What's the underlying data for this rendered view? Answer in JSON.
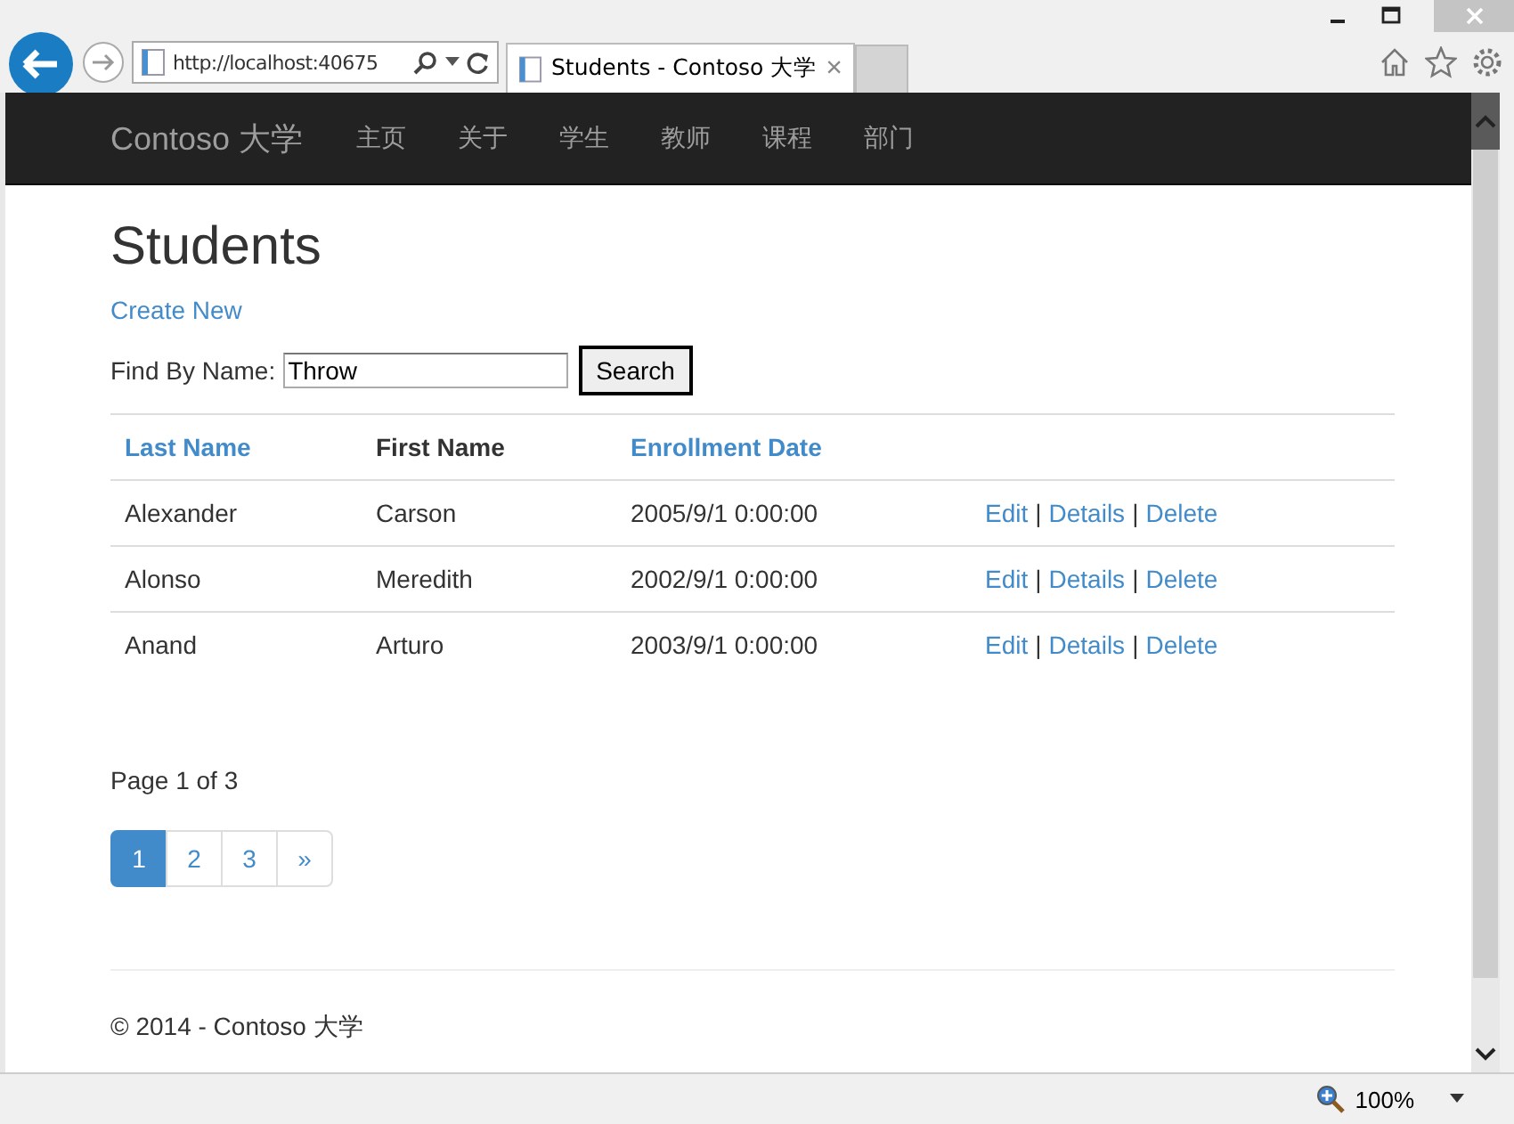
{
  "browser": {
    "address": "http://localhost:40675",
    "tab_title": "Students - Contoso 大学",
    "tab_close": "×",
    "zoom": "100%"
  },
  "navbar": {
    "brand": "Contoso 大学",
    "items": [
      "主页",
      "关于",
      "学生",
      "教师",
      "课程",
      "部门"
    ]
  },
  "page": {
    "title": "Students",
    "create_link": "Create New",
    "search_label": "Find By Name:",
    "search_value": "Throw",
    "search_button": "Search"
  },
  "table": {
    "columns": [
      {
        "label": "Last Name",
        "kind": "link"
      },
      {
        "label": "First Name",
        "kind": "text"
      },
      {
        "label": "Enrollment Date",
        "kind": "link"
      }
    ],
    "rows": [
      {
        "cells": [
          "Alexander",
          "Carson",
          "2005/9/1 0:00:00"
        ],
        "actions": [
          {
            "label": "Edit",
            "kind": "link"
          },
          {
            "label": "|",
            "kind": "separator"
          },
          {
            "label": "Details",
            "kind": "link"
          },
          {
            "label": "|",
            "kind": "separator"
          },
          {
            "label": "Delete",
            "kind": "link"
          }
        ]
      },
      {
        "cells": [
          "Alonso",
          "Meredith",
          "2002/9/1 0:00:00"
        ],
        "actions": [
          {
            "label": "Edit",
            "kind": "link"
          },
          {
            "label": "|",
            "kind": "separator"
          },
          {
            "label": "Details",
            "kind": "link"
          },
          {
            "label": "|",
            "kind": "separator"
          },
          {
            "label": "Delete",
            "kind": "link"
          }
        ]
      },
      {
        "cells": [
          "Anand",
          "Arturo",
          "2003/9/1 0:00:00"
        ],
        "actions": [
          {
            "label": "Edit",
            "kind": "link"
          },
          {
            "label": "|",
            "kind": "separator"
          },
          {
            "label": "Details",
            "kind": "link"
          },
          {
            "label": "|",
            "kind": "separator"
          },
          {
            "label": "Delete",
            "kind": "link"
          }
        ]
      }
    ]
  },
  "pager": {
    "summary": "Page 1 of 3",
    "pages": [
      {
        "label": "1",
        "selected": true
      },
      {
        "label": "2",
        "selected": false
      },
      {
        "label": "3",
        "selected": false
      },
      {
        "label": "»",
        "selected": false
      }
    ]
  },
  "footer": {
    "text": "© 2014 - Contoso 大学"
  }
}
